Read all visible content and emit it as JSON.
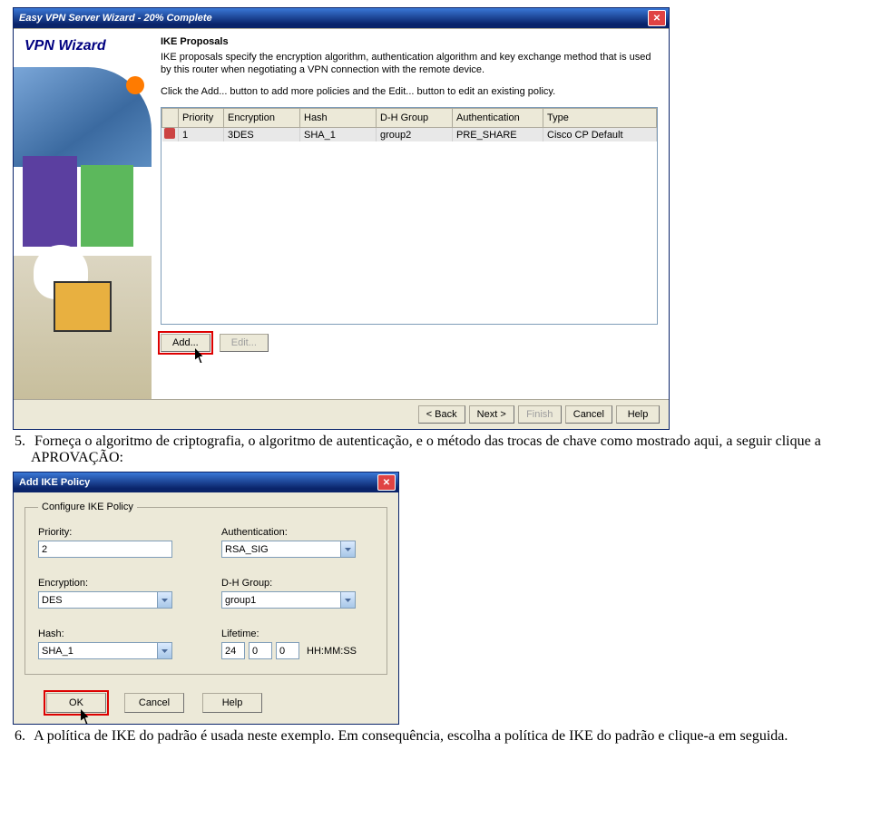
{
  "wizard": {
    "title": "Easy VPN Server Wizard - 20% Complete",
    "sidebar_label": "VPN Wizard",
    "heading": "IKE Proposals",
    "para1": "IKE proposals specify the encryption algorithm, authentication algorithm and key exchange method that is used by this router when negotiating a VPN connection with the remote device.",
    "para2": "Click the Add... button to add more policies and the Edit... button to edit an existing policy.",
    "table": {
      "headers": [
        "",
        "Priority",
        "Encryption",
        "Hash",
        "D-H Group",
        "Authentication",
        "Type"
      ],
      "row": {
        "priority": "1",
        "encryption": "3DES",
        "hash": "SHA_1",
        "dh": "group2",
        "auth": "PRE_SHARE",
        "type": "Cisco CP Default"
      }
    },
    "buttons": {
      "add": "Add...",
      "edit": "Edit..."
    },
    "footer": {
      "back": "< Back",
      "next": "Next >",
      "finish": "Finish",
      "cancel": "Cancel",
      "help": "Help"
    }
  },
  "instruction5": {
    "num": "5.",
    "text": "Forneça o algoritmo de criptografia, o algoritmo de autenticação, e o método das trocas de chave como mostrado aqui, a seguir clique a APROVAÇÃO:"
  },
  "dialog": {
    "title": "Add IKE Policy",
    "legend": "Configure IKE Policy",
    "fields": {
      "priority_label": "Priority:",
      "priority_value": "2",
      "authentication_label": "Authentication:",
      "authentication_value": "RSA_SIG",
      "encryption_label": "Encryption:",
      "encryption_value": "DES",
      "dh_label": "D-H Group:",
      "dh_value": "group1",
      "hash_label": "Hash:",
      "hash_value": "SHA_1",
      "lifetime_label": "Lifetime:",
      "lifetime_h": "24",
      "lifetime_m": "0",
      "lifetime_s": "0",
      "lifetime_suffix": "HH:MM:SS"
    },
    "buttons": {
      "ok": "OK",
      "cancel": "Cancel",
      "help": "Help"
    }
  },
  "instruction6": {
    "num": "6.",
    "text": "A política de IKE do padrão é usada neste exemplo. Em consequência, escolha a política de IKE do padrão e clique-a em seguida."
  }
}
